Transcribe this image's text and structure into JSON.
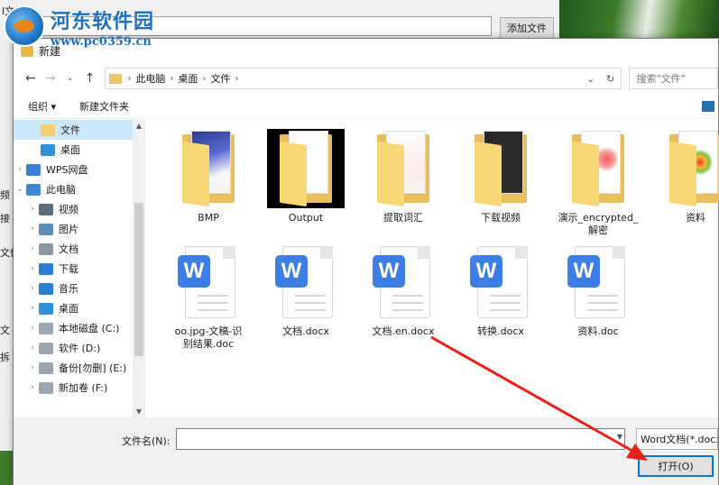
{
  "watermark": {
    "site_name": "河东软件园",
    "url": "www.pc0359.cn"
  },
  "parent_window": {
    "title_fragment": "l文件",
    "add_file_button": "添加文件",
    "left_labels": [
      "频",
      "接",
      "文件",
      "文",
      "拆"
    ]
  },
  "dialog": {
    "title": "新建",
    "breadcrumb": [
      "此电脑",
      "桌面",
      "文件"
    ],
    "search_placeholder": "搜索\"文件\"",
    "toolbar": {
      "organize": "组织 ▾",
      "new_folder": "新建文件夹"
    },
    "sidebar": [
      {
        "label": "文件",
        "icon": "folder-icon",
        "expander": "",
        "selected": true
      },
      {
        "label": "桌面",
        "icon": "desktop-icon",
        "expander": "",
        "selected": false
      },
      {
        "label": "WPS网盘",
        "icon": "cloud-icon",
        "expander": "›",
        "selected": false
      },
      {
        "label": "此电脑",
        "icon": "computer-icon",
        "expander": "⌄",
        "selected": false
      },
      {
        "label": "视频",
        "icon": "video-icon",
        "expander": "›",
        "selected": false
      },
      {
        "label": "图片",
        "icon": "picture-icon",
        "expander": "›",
        "selected": false
      },
      {
        "label": "文档",
        "icon": "document-icon",
        "expander": "›",
        "selected": false
      },
      {
        "label": "下载",
        "icon": "download-icon",
        "expander": "›",
        "selected": false
      },
      {
        "label": "音乐",
        "icon": "music-icon",
        "expander": "›",
        "selected": false
      },
      {
        "label": "桌面",
        "icon": "desktop-icon",
        "expander": "›",
        "selected": false
      },
      {
        "label": "本地磁盘 (C:)",
        "icon": "drive-icon",
        "expander": "›",
        "selected": false
      },
      {
        "label": "软件 (D:)",
        "icon": "drive-icon",
        "expander": "›",
        "selected": false
      },
      {
        "label": "备份[勿删] (E:)",
        "icon": "drive-icon",
        "expander": "›",
        "selected": false
      },
      {
        "label": "新加卷 (F:)",
        "icon": "drive-icon",
        "expander": "›",
        "selected": false
      }
    ],
    "folders": [
      {
        "name": "BMP"
      },
      {
        "name": "Output"
      },
      {
        "name": "提取词汇"
      },
      {
        "name": "下载视频"
      },
      {
        "name": "演示_encrypted_\n解密"
      },
      {
        "name": "资料"
      }
    ],
    "files": [
      {
        "name": "oo.jpg-文稿-识\n别结果.doc"
      },
      {
        "name": "文档.docx"
      },
      {
        "name": "文档.en.docx"
      },
      {
        "name": "转换.docx"
      },
      {
        "name": "资料.doc"
      }
    ],
    "filename_label": "文件名(N):",
    "filename_value": "",
    "filetype": "Word文档(*.docx",
    "open_button": "打开(O)"
  }
}
